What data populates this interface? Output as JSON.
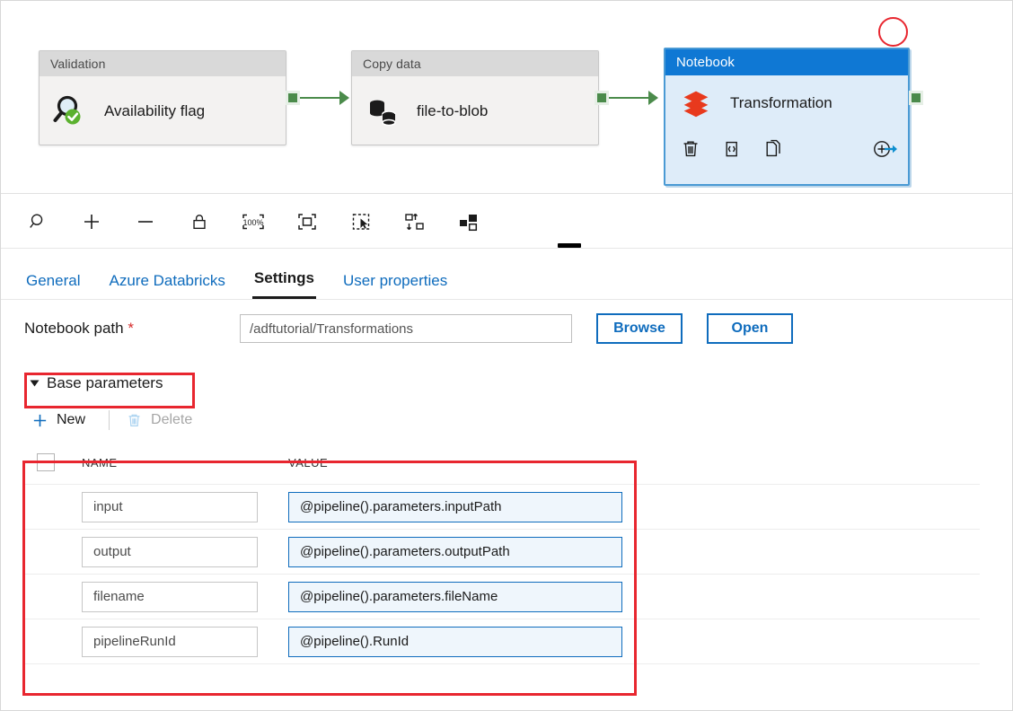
{
  "canvas": {
    "nodes": [
      {
        "type_label": "Validation",
        "name": "Availability flag",
        "icon": "magnifier-check-icon"
      },
      {
        "type_label": "Copy data",
        "name": "file-to-blob",
        "icon": "database-copy-icon"
      },
      {
        "type_label": "Notebook",
        "name": "Transformation",
        "icon": "databricks-icon"
      }
    ],
    "selected_node_actions": [
      {
        "icon": "delete-icon",
        "label": "Delete"
      },
      {
        "icon": "code-icon",
        "label": "View code"
      },
      {
        "icon": "clone-icon",
        "label": "Clone"
      },
      {
        "icon": "add-output-icon",
        "label": "Add output"
      }
    ],
    "annotation": "red-circle-highlight"
  },
  "toolbar": {
    "buttons": [
      {
        "icon": "zoom-search-icon",
        "label": "Zoom"
      },
      {
        "icon": "zoom-in-icon",
        "label": "Zoom in"
      },
      {
        "icon": "zoom-out-icon",
        "label": "Zoom out"
      },
      {
        "icon": "lock-icon",
        "label": "Lock canvas"
      },
      {
        "icon": "zoom-100-icon",
        "label": "100%"
      },
      {
        "icon": "fit-to-screen-icon",
        "label": "Zoom to fit"
      },
      {
        "icon": "select-pointer-icon",
        "label": "Select"
      },
      {
        "icon": "auto-align-icon",
        "label": "Auto align"
      },
      {
        "icon": "layout-icon",
        "label": "Layout"
      }
    ],
    "zoom_label": "100%"
  },
  "tabs": [
    {
      "label": "General",
      "active": false
    },
    {
      "label": "Azure Databricks",
      "active": false
    },
    {
      "label": "Settings",
      "active": true
    },
    {
      "label": "User properties",
      "active": false
    }
  ],
  "settings": {
    "notebook_path": {
      "label": "Notebook path",
      "required_marker": "*",
      "value": "/adftutorial/Transformations",
      "placeholder": "/adftutorial/Transformations"
    },
    "browse_label": "Browse",
    "open_label": "Open",
    "base_parameters": {
      "section_label": "Base parameters",
      "new_label": "New",
      "delete_label": "Delete",
      "columns": [
        "NAME",
        "VALUE"
      ],
      "rows": [
        {
          "name": "input",
          "value": "@pipeline().parameters.inputPath"
        },
        {
          "name": "output",
          "value": "@pipeline().parameters.outputPath"
        },
        {
          "name": "filename",
          "value": "@pipeline().parameters.fileName"
        },
        {
          "name": "pipelineRunId",
          "value": "@pipeline().RunId"
        }
      ]
    }
  },
  "colors": {
    "accent_blue": "#0f6cbd",
    "header_blue": "#0f78d4",
    "selected_body": "#deecf9",
    "connector_green": "#4b8b4b",
    "annotation_red": "#e8262f",
    "databricks_red": "#e8391d",
    "required_red": "#d62c2c"
  }
}
